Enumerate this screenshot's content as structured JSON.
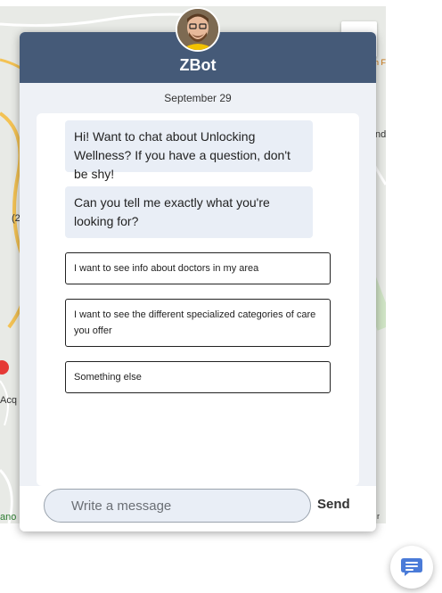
{
  "bot": {
    "name": "ZBot",
    "avatar_icon": "user-photo"
  },
  "conversation": {
    "date": "September 29",
    "messages": [
      "Hi! Want to chat about Unlocking Wellness? If you have a question, don't be shy!",
      "Can you tell me exactly what you're looking for?"
    ],
    "options": [
      "I want to see info about doctors in my area",
      "I want to see the different specialized categories of care you offer",
      "Something else"
    ]
  },
  "composer": {
    "placeholder": "Write a message",
    "send_label": "Send"
  },
  "launcher": {
    "icon": "chat-icon"
  },
  "map": {
    "labels": [
      "(2",
      "Acq",
      "nd",
      "n F",
      "ano",
      "r"
    ]
  },
  "colors": {
    "header": "#455a78",
    "panel": "#eef1f6",
    "bubble": "#e9eef6",
    "launcher_icon": "#4a7bd8"
  }
}
